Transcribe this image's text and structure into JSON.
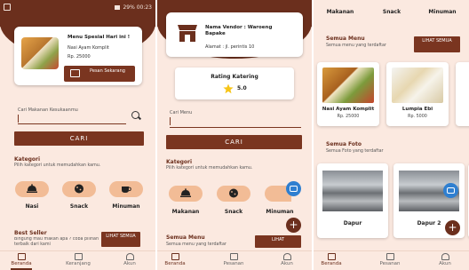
{
  "screen1": {
    "status_text": "29% 00:23",
    "promo": {
      "title": "Menu Spesial Hari ini !",
      "item": "Nasi Ayam Komplit",
      "price": "Rp. 25000",
      "button": "Pesan Sekarang"
    },
    "search": {
      "label": "Cari Makanan Kesukaanmu",
      "button": "CARI"
    },
    "kategori": {
      "title": "Kategori",
      "subtitle": "Pilih kategori untuk memudahkan kamu.",
      "items": [
        {
          "label": "Nasi",
          "icon": "bell-dish-icon"
        },
        {
          "label": "Snack",
          "icon": "cookie-icon"
        },
        {
          "label": "Minuman",
          "icon": "cup-icon"
        }
      ]
    },
    "best_seller": {
      "title": "Best Seller",
      "subtitle": "Bingung mau makan apa ? coba pilihan terbaik dari kami",
      "button": "LIHAT SEMUA"
    },
    "nav": [
      "Beranda",
      "Keranjang",
      "Akun"
    ]
  },
  "screen2": {
    "vendor": {
      "name": "Nama Vendor : Waroeng Bapake",
      "address": "Alamat : jl. perintis 10"
    },
    "rating": {
      "title": "Rating Katering",
      "value": "5.0"
    },
    "search": {
      "label": "Cari Menu",
      "button": "CARI"
    },
    "kategori": {
      "title": "Kategori",
      "subtitle": "Pilih kategori untuk memudahkan kamu.",
      "items": [
        {
          "label": "Makanan",
          "icon": "bell-dish-icon"
        },
        {
          "label": "Snack",
          "icon": "cookie-icon"
        },
        {
          "label": "Minuman",
          "icon": "cup-icon"
        }
      ]
    },
    "semua_menu": {
      "title": "Semua Menu",
      "subtitle": "Semua menu yang terdaftar",
      "button": "LIHAT"
    },
    "nav": [
      "Beranda",
      "Pesanan",
      "Akun"
    ]
  },
  "screen3": {
    "top_cats": [
      "Makanan",
      "Snack",
      "Minuman"
    ],
    "semua_menu": {
      "title": "Semua Menu",
      "subtitle": "Semua menu yang terdaftar",
      "button": "LIHAT SEMUA"
    },
    "menus": [
      {
        "name": "Nasi Ayam Komplit",
        "price": "Rp. 25000"
      },
      {
        "name": "Lumpia Ebi",
        "price": "Rp. 5000"
      }
    ],
    "semua_foto": {
      "title": "Semua Foto",
      "subtitle": "Semua Foto yang terdaftar"
    },
    "fotos": [
      "Dapur",
      "Dapur 2"
    ],
    "nav": [
      "Beranda",
      "Pesanan",
      "Akun"
    ]
  },
  "colors": {
    "brand": "#6b2f1d",
    "bg": "#fbe9e0",
    "accent": "#f2bc96",
    "camera": "#2f7fd0"
  }
}
